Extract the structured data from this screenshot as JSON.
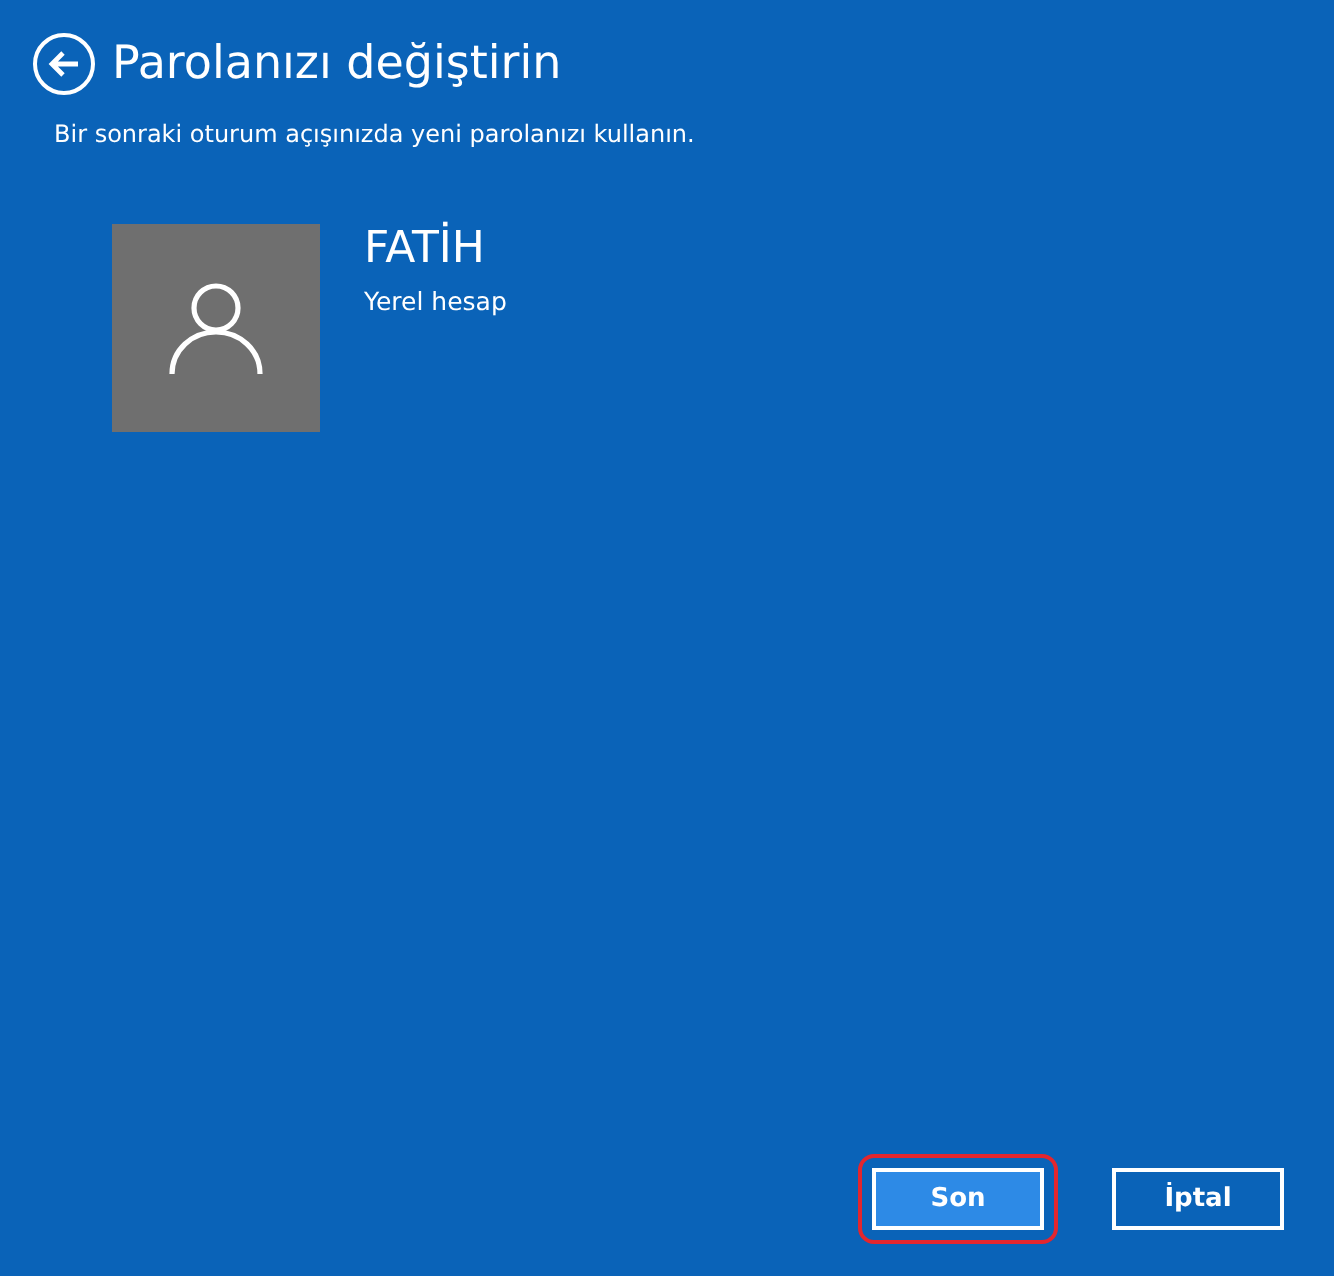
{
  "header": {
    "title": "Parolanızı değiştirin",
    "subtitle": "Bir sonraki oturum açışınızda yeni parolanızı kullanın."
  },
  "account": {
    "name": "FATİH",
    "type": "Yerel hesap"
  },
  "buttons": [
    {
      "label": "Son",
      "kind": "primary",
      "highlighted": true
    },
    {
      "label": "İptal",
      "kind": "secondary",
      "highlighted": false
    }
  ]
}
